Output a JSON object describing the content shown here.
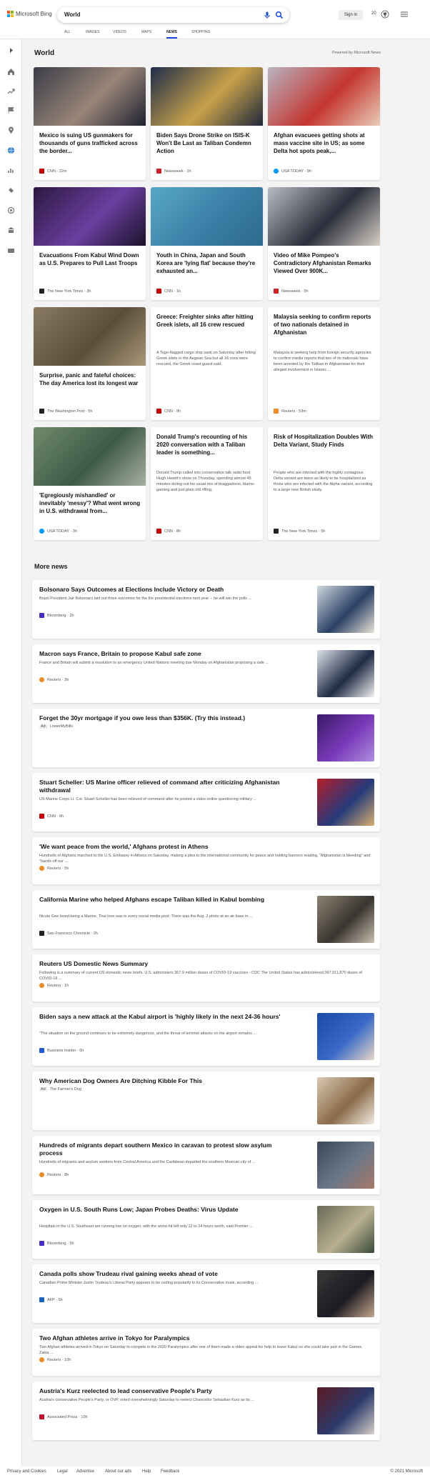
{
  "header": {
    "brand": "Microsoft Bing",
    "query": "World",
    "signin": "Sign in",
    "points": "20"
  },
  "scopes": [
    "ALL",
    "IMAGES",
    "VIDEOS",
    "MAPS",
    "NEWS",
    "SHOPPING"
  ],
  "section": {
    "title": "World",
    "powered": "Powered by Microsoft News"
  },
  "cards": [
    {
      "title": "Mexico is suing US gunmakers for thousands of guns trafficked across the border...",
      "abstract": "",
      "source": "CNN",
      "time": "22m",
      "logo_color": "#cc0000",
      "image_colors": [
        "#3a3d48",
        "#9a8578",
        "#1e2230"
      ]
    },
    {
      "title": "Biden Says Drone Strike on ISIS-K Won't Be Last as Taliban Condemn Action",
      "abstract": "",
      "source": "Newsweek",
      "time": "1h",
      "logo_color": "#d41f26",
      "image_colors": [
        "#1f2c4a",
        "#c8a24a",
        "#20283b"
      ]
    },
    {
      "title": "Afghan evacuees getting shots at mass vaccine site in US; as some Delta hot spots peak,...",
      "abstract": "",
      "source": "USA TODAY",
      "time": "9h",
      "logo_color": "#009bff",
      "image_colors": [
        "#b7b3c0",
        "#c4352f",
        "#e8ccb8"
      ]
    },
    {
      "title": "Evacuations From Kabul Wind Down as U.S. Prepares to Pull Last Troops",
      "abstract": "",
      "source": "The New York Times",
      "time": "3h",
      "logo_color": "#222222",
      "image_colors": [
        "#2b1840",
        "#6b3fa0",
        "#1a1228"
      ]
    },
    {
      "title": "Youth in China, Japan and South Korea are 'lying flat' because they're exhausted an...",
      "abstract": "",
      "source": "CNN",
      "time": "1h",
      "logo_color": "#cc0000",
      "image_colors": [
        "#58a8c8",
        "#3b7fa6",
        "#2d6a8e"
      ]
    },
    {
      "title": "Video of Mike Pompeo's Contradictory Afghanistan Remarks Viewed Over 900K...",
      "abstract": "",
      "source": "Newsweek",
      "time": "5h",
      "logo_color": "#d41f26",
      "image_colors": [
        "#b9bcc4",
        "#2a2e3a",
        "#d8d0c8"
      ]
    },
    {
      "title": "Surprise, panic and fateful choices: The day America lost its longest war",
      "abstract": "",
      "source": "The Washington Post",
      "time": "5h",
      "logo_color": "#222222",
      "image_colors": [
        "#8a7a62",
        "#5a4d3a",
        "#a89878"
      ]
    },
    {
      "title": "Greece: Freighter sinks after hitting Greek islets, all 16 crew rescued",
      "abstract": "A Togo-flagged cargo ship sank on Saturday after hitting Greek islets in the Aegean Sea but all 16 crew were rescued, the Greek coast guard said.",
      "source": "CNN",
      "time": "9h",
      "logo_color": "#cc0000",
      "image_colors": []
    },
    {
      "title": "Malaysia seeking to confirm reports of two nationals detained in Afghanistan",
      "abstract": "Malaysia is seeking help from foreign security agencies to confirm media reports that two of its nationals have been arrested by the Taliban in Afghanistan for their alleged involvement in Islamic ...",
      "source": "Reuters",
      "time": "53m",
      "logo_color": "#f08a24",
      "image_colors": []
    },
    {
      "title": "'Egregiously mishandled' or inevitably 'messy'? What went wrong in U.S. withdrawal from...",
      "abstract": "",
      "source": "USA TODAY",
      "time": "3h",
      "logo_color": "#009bff",
      "image_colors": [
        "#6f8a6a",
        "#3e5a48",
        "#a8b0a0"
      ]
    },
    {
      "title": "Donald Trump's recounting of his 2020 conversation with a Taliban leader is something...",
      "abstract": "Donald Trump called into conservative talk radio host Hugh Hewitt's show on Thursday, spending almost 45 minutes doling out his usual mix of braggadocio, blame-gaming and just plain old riffing.",
      "source": "CNN",
      "time": "8h",
      "logo_color": "#cc0000",
      "image_colors": []
    },
    {
      "title": "Risk of Hospitalization Doubles With Delta Variant, Study Finds",
      "abstract": "People who are infected with the highly contagious Delta variant are twice as likely to be hospitalized as those who are infected with the Alpha variant, according to a large new British study.",
      "source": "The New York Times",
      "time": "5h",
      "logo_color": "#222222",
      "image_colors": []
    }
  ],
  "more": {
    "title": "More news"
  },
  "rows": [
    {
      "title": "Bolsonaro Says Outcomes at Elections Include Victory or Death",
      "snippet": "Brazil President Jair Bolsonaro laid out three outcomes for the the presidential elections next year -- he will win the polls ...",
      "source": "Bloomberg",
      "time": "2h",
      "ad": false,
      "logo_color": "#472cd0",
      "image_colors": [
        "#cfd8de",
        "#2a4066",
        "#e9e2d6"
      ]
    },
    {
      "title": "Macron says France, Britain to propose Kabul safe zone",
      "snippet": "France and Britain will submit a resolution to an emergency United Nations meeting due Monday on Afghanistan proposing a safe ...",
      "source": "Reuters",
      "time": "3h",
      "ad": false,
      "logo_color": "#f08a24",
      "image_colors": [
        "#dde3ea",
        "#1f2a44",
        "#f2f2f2"
      ]
    },
    {
      "title": "Forget the 30yr mortgage if you owe less than $356K. (Try this instead.)",
      "snippet": "",
      "source": "LowerMyBills",
      "time": "",
      "ad": true,
      "logo_color": "",
      "image_colors": [
        "#3a1a6a",
        "#7a3ab8",
        "#b090e0"
      ]
    },
    {
      "title": "Stuart Scheller: US Marine officer relieved of command after criticizing Afghanistan withdrawal",
      "snippet": "US Marine Corps Lt. Col. Stuart Scheller has been relieved of command after he posted a video online questioning military ...",
      "source": "CNN",
      "time": "6h",
      "ad": false,
      "logo_color": "#cc0000",
      "image_colors": [
        "#b51e2a",
        "#243a7a",
        "#d8b070"
      ]
    },
    {
      "title": "'We want peace from the world,' Afghans protest in Athens",
      "snippet": "Hundreds of Afghans marched to the U.S. Embassy in Athens on Saturday, making a plea to the international community for peace and holding banners reading, \"Afghanistan is bleeding\" and \"hands off our ...",
      "source": "Reuters",
      "time": "5h",
      "ad": false,
      "logo_color": "#f08a24",
      "image_colors": []
    },
    {
      "title": "California Marine who helped Afghans escape Taliban killed in Kabul bombing",
      "snippet": "Nicole Gee loved being a Marine. That love was in every social media post. There was the Aug. 2 photo at an air base in ...",
      "source": "San Francisco Chronicle",
      "time": "2h",
      "ad": false,
      "logo_color": "#222222",
      "image_colors": [
        "#8a8272",
        "#3a3530",
        "#c8c0b0"
      ]
    },
    {
      "title": "Reuters US Domestic News Summary",
      "snippet": "Following is a summary of current US domestic news briefs. U.S. administers 367.9 million doses of COVID-19 vaccines - CDC The United States has administered 367,911,870 doses of COVID-19 ...",
      "source": "Reuters",
      "time": "1h",
      "ad": false,
      "logo_color": "#f08a24",
      "image_colors": []
    },
    {
      "title": "Biden says a new attack at the Kabul airport is 'highly likely in the next 24-36 hours'",
      "snippet": "\"The situation on the ground continues to be extremely dangerous, and the threat of terrorist attacks on the airport remains ...",
      "source": "Business Insider",
      "time": "6h",
      "ad": false,
      "logo_color": "#1f5bd6",
      "image_colors": [
        "#1a4aa8",
        "#3a6ac8",
        "#e8d8c8"
      ]
    },
    {
      "title": "Why American Dog Owners Are Ditching Kibble For This",
      "snippet": "",
      "source": "The Farmer's Dog",
      "time": "",
      "ad": true,
      "logo_color": "",
      "image_colors": [
        "#d8c8b0",
        "#8a6a48",
        "#f2ece2"
      ]
    },
    {
      "title": "Hundreds of migrants depart southern Mexico in caravan to protest slow asylum process",
      "snippet": "Hundreds of migrants and asylum seekers from Central America and the Caribbean departed the southern Mexican city of ...",
      "source": "Reuters",
      "time": "8h",
      "ad": false,
      "logo_color": "#f08a24",
      "image_colors": [
        "#3a4858",
        "#6a7888",
        "#a87868"
      ]
    },
    {
      "title": "Oxygen in U.S. South Runs Low; Japan Probes Deaths: Virus Update",
      "snippet": "Hospitals in the U.S. Southeast are running low on oxygen, with the worst-hit left only 12 to 24 hours worth, said Premier ...",
      "source": "Bloomberg",
      "time": "5h",
      "ad": false,
      "logo_color": "#472cd0",
      "image_colors": [
        "#6a6a58",
        "#b8b090",
        "#3a4a3a"
      ]
    },
    {
      "title": "Canada polls show Trudeau rival gaining weeks ahead of vote",
      "snippet": "Canadian Prime Minister Justin Trudeau's Liberal Party appears to be ceding popularity to its Conservative rivals, according ...",
      "source": "AFP",
      "time": "5h",
      "ad": false,
      "logo_color": "#1565c0",
      "image_colors": [
        "#3a3838",
        "#1a1a22",
        "#c8a890"
      ]
    },
    {
      "title": "Two Afghan athletes arrive in Tokyo for Paralympics",
      "snippet": "Two Afghan athletes arrived in Tokyo on Saturday to compete in the 2020 Paralympics after one of them made a video appeal for help to leave Kabul so she could take part in the Games. Zakia ...",
      "source": "Reuters",
      "time": "10h",
      "ad": false,
      "logo_color": "#f08a24",
      "image_colors": []
    },
    {
      "title": "Austria's Kurz reelected to lead conservative People's Party",
      "snippet": "Austria's conservative People's Party, or ÖVP, voted overwhelmingly Saturday to reelect Chancellor Sebastian Kurz as its ...",
      "source": "Associated Press",
      "time": "10h",
      "ad": false,
      "logo_color": "#c8102e",
      "image_colors": [
        "#5a1a22",
        "#2a3a6a",
        "#d8d0c8"
      ]
    }
  ],
  "ad_label": "Ad",
  "footer": {
    "links": [
      "Privacy and Cookies",
      "Legal",
      "Advertise",
      "About our ads",
      "Help",
      "Feedback"
    ],
    "copyright": "© 2021 Microsoft"
  }
}
